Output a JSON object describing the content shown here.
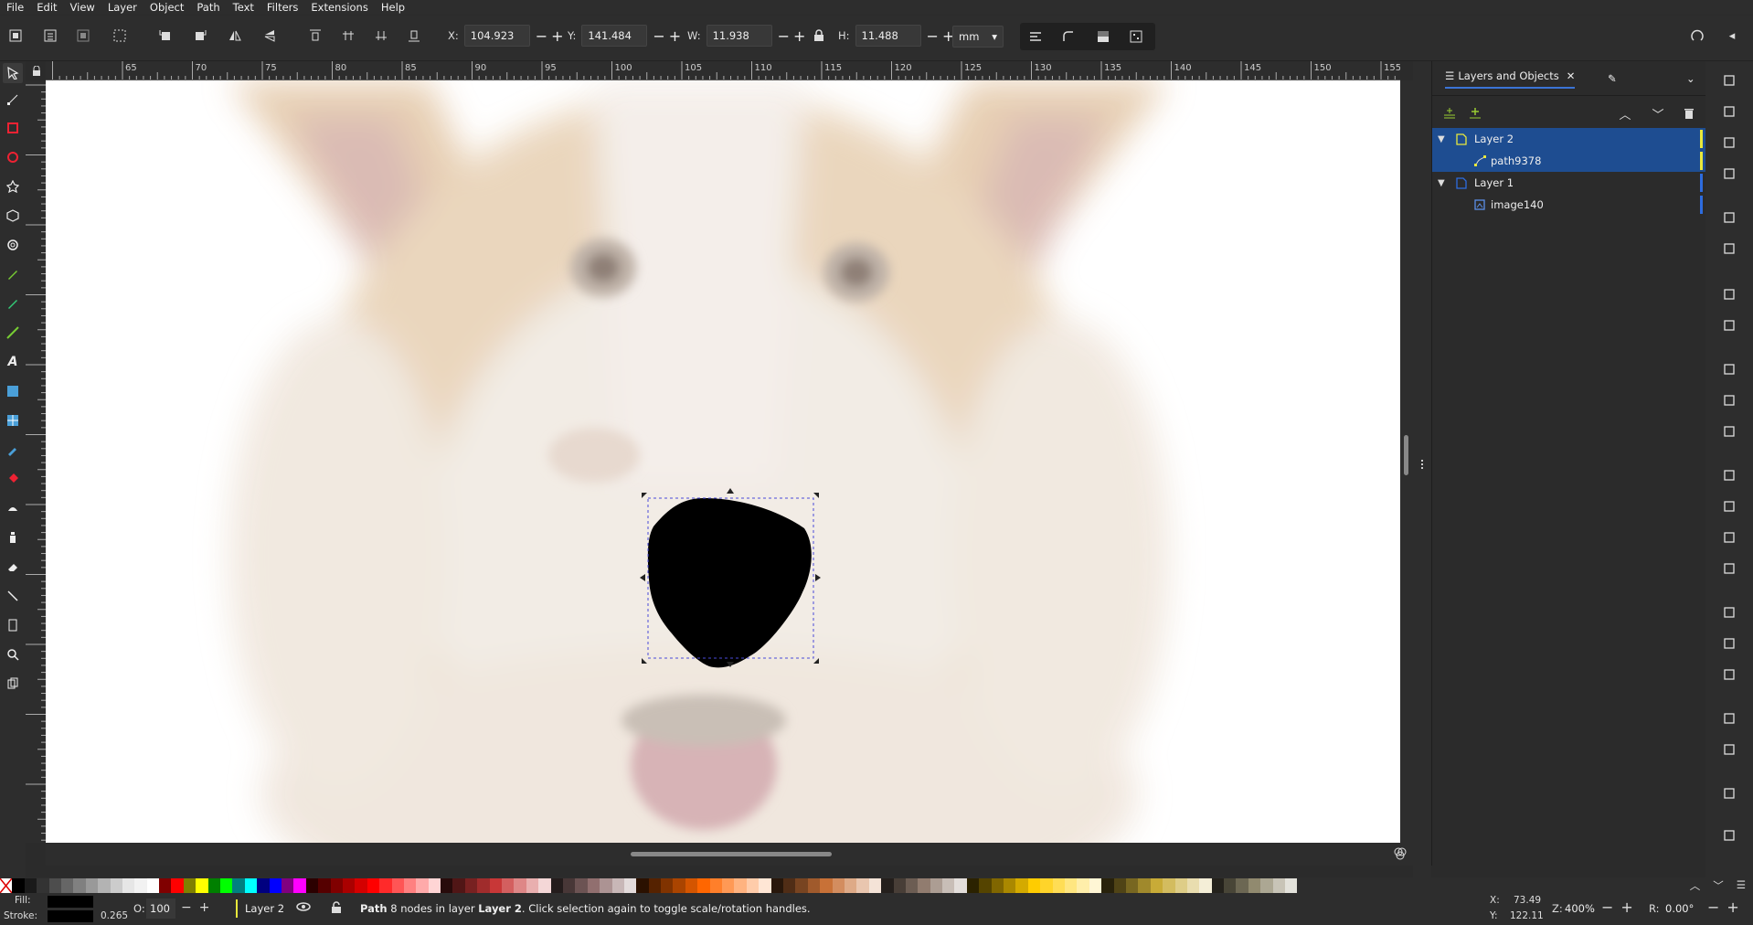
{
  "menu": [
    "File",
    "Edit",
    "View",
    "Layer",
    "Object",
    "Path",
    "Text",
    "Filters",
    "Extensions",
    "Help"
  ],
  "controls": {
    "x_label": "X:",
    "x_value": "104.923",
    "y_label": "Y:",
    "y_value": "141.484",
    "w_label": "W:",
    "w_value": "11.938",
    "h_label": "H:",
    "h_value": "11.488",
    "unit": "mm"
  },
  "ruler_h_labels": [
    "65",
    "70",
    "75",
    "80",
    "85",
    "90",
    "95",
    "100",
    "105",
    "110",
    "115",
    "120",
    "125",
    "130",
    "135",
    "140",
    "145",
    "150",
    "155"
  ],
  "panel": {
    "tab_label": "Layers and Objects",
    "rows": [
      {
        "label": "Layer 2",
        "type": "layer",
        "indent": 0,
        "selected": true,
        "color": "#e8e83c"
      },
      {
        "label": "path9378",
        "type": "path",
        "indent": 1,
        "selected": true,
        "color": "#e8e83c"
      },
      {
        "label": "Layer 1",
        "type": "layer",
        "indent": 0,
        "selected": false,
        "color": "#2d6cdf"
      },
      {
        "label": "image140",
        "type": "image",
        "indent": 1,
        "selected": false,
        "color": "#2d6cdf"
      }
    ]
  },
  "status": {
    "fill_label": "Fill:",
    "stroke_label": "Stroke:",
    "stroke_width": "0.265",
    "opacity_label": "O:",
    "opacity_value": "100",
    "layer": "Layer 2",
    "message_bold": "Path",
    "message_a": " 8 nodes in layer ",
    "message_layer": "Layer 2",
    "message_b": ". Click selection again to toggle scale/rotation handles.",
    "cursor_x_label": "X:",
    "cursor_x": "73.49",
    "cursor_y_label": "Y:",
    "cursor_y": "122.11",
    "zoom_label": "Z:",
    "zoom": "400%",
    "rotation_label": "R:",
    "rotation": "0.00°"
  },
  "colors": {
    "accent": "#1e4d91",
    "selection": "#1e4d91",
    "fill": "#000000"
  }
}
